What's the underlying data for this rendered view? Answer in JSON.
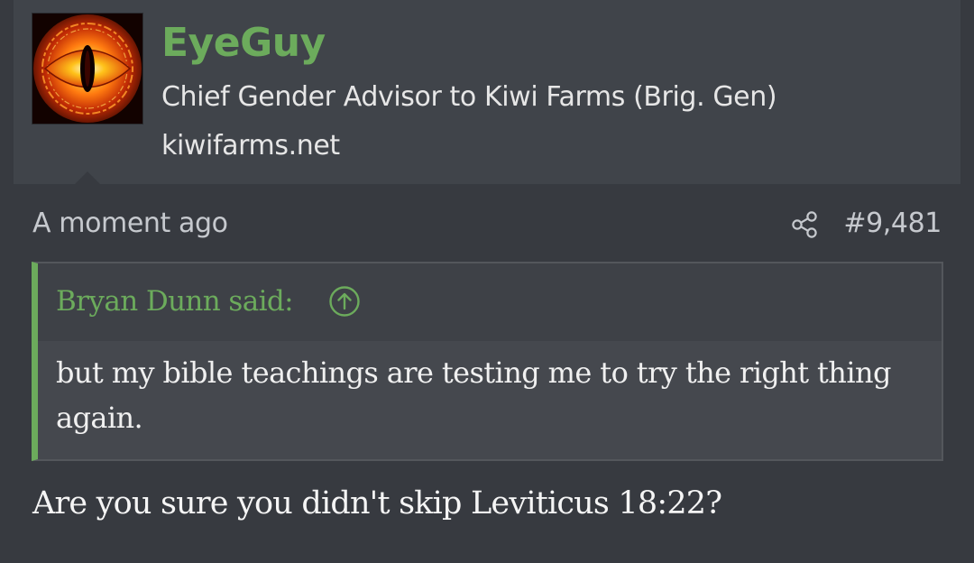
{
  "user": {
    "name": "EyeGuy",
    "title": "Chief Gender Advisor to Kiwi Farms (Brig. Gen)",
    "site": "kiwifarms.net",
    "avatar_icon": "eye-of-sauron-icon"
  },
  "post": {
    "timestamp": "A moment ago",
    "number": "#9,481",
    "share_icon": "share-icon"
  },
  "quote": {
    "author_said": "Bryan Dunn said:",
    "jump_icon": "arrow-up-circle-icon",
    "body": "but my bible teachings are testing me to try the right thing again."
  },
  "reply": {
    "text": "Are you sure you didn't skip Leviticus 18:22?"
  },
  "colors": {
    "accent": "#6cab5c",
    "background": "#373a40",
    "header_background": "#40444a",
    "quote_background": "#45484e"
  }
}
